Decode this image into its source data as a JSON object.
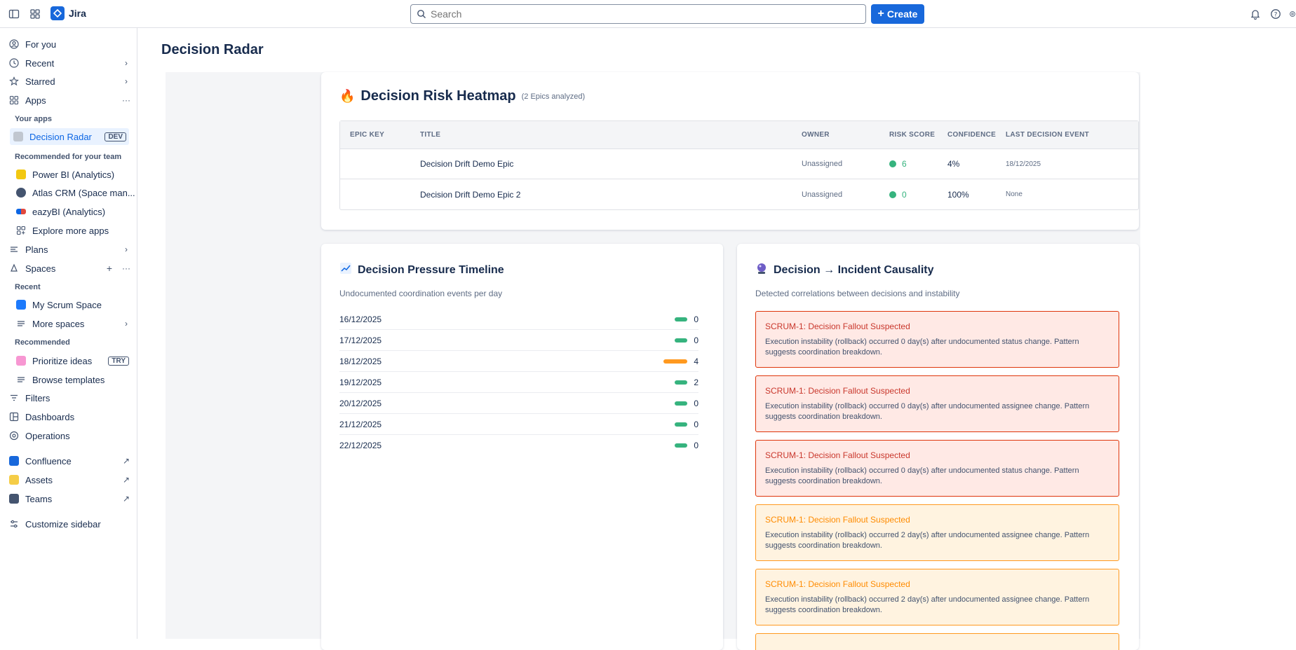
{
  "topbar": {
    "app_name": "Jira",
    "search_placeholder": "Search",
    "create_label": "Create"
  },
  "sidebar": {
    "for_you": "For you",
    "recent": "Recent",
    "starred": "Starred",
    "apps": "Apps",
    "your_apps_heading": "Your apps",
    "decision_radar": "Decision Radar",
    "decision_radar_badge": "DEV",
    "recommended_team_heading": "Recommended for your team",
    "power_bi": "Power BI (Analytics)",
    "atlas_crm": "Atlas CRM (Space man...",
    "eazybi": "eazyBI (Analytics)",
    "explore_apps": "Explore more apps",
    "plans": "Plans",
    "spaces": "Spaces",
    "spaces_recent_heading": "Recent",
    "my_scrum_space": "My Scrum Space",
    "more_spaces": "More spaces",
    "recommended_heading": "Recommended",
    "prioritize_ideas": "Prioritize ideas",
    "prioritize_badge": "TRY",
    "browse_templates": "Browse templates",
    "filters": "Filters",
    "dashboards": "Dashboards",
    "operations": "Operations",
    "confluence": "Confluence",
    "assets": "Assets",
    "teams": "Teams",
    "customize": "Customize sidebar"
  },
  "page": {
    "title": "Decision Radar"
  },
  "heatmap": {
    "title": "Decision Risk Heatmap",
    "subtitle": "(2 Epics analyzed)",
    "headers": {
      "epic_key": "EPIC KEY",
      "title": "TITLE",
      "owner": "OWNER",
      "risk": "RISK SCORE",
      "confidence": "CONFIDENCE",
      "last_event": "LAST DECISION EVENT"
    },
    "rows": [
      {
        "epic_key": "",
        "title": "Decision Drift Demo Epic",
        "owner": "Unassigned",
        "risk": "6",
        "confidence": "4%",
        "last_event": "18/12/2025"
      },
      {
        "epic_key": "",
        "title": "Decision Drift Demo Epic 2",
        "owner": "Unassigned",
        "risk": "0",
        "confidence": "100%",
        "last_event": "None"
      }
    ]
  },
  "timeline": {
    "title": "Decision Pressure Timeline",
    "subtitle": "Undocumented coordination events per day",
    "rows": [
      {
        "date": "16/12/2025",
        "count": "0"
      },
      {
        "date": "17/12/2025",
        "count": "0"
      },
      {
        "date": "18/12/2025",
        "count": "4"
      },
      {
        "date": "19/12/2025",
        "count": "2"
      },
      {
        "date": "20/12/2025",
        "count": "0"
      },
      {
        "date": "21/12/2025",
        "count": "0"
      },
      {
        "date": "22/12/2025",
        "count": "0"
      }
    ]
  },
  "causality": {
    "title": "Decision → Incident Causality",
    "subtitle": "Detected correlations between decisions and instability",
    "alerts": [
      {
        "title": "SCRUM-1: Decision Fallout Suspected",
        "body": "Execution instability (rollback) occurred 0 day(s) after undocumented status change. Pattern suggests coordination breakdown."
      },
      {
        "title": "SCRUM-1: Decision Fallout Suspected",
        "body": "Execution instability (rollback) occurred 0 day(s) after undocumented assignee change. Pattern suggests coordination breakdown."
      },
      {
        "title": "SCRUM-1: Decision Fallout Suspected",
        "body": "Execution instability (rollback) occurred 0 day(s) after undocumented status change. Pattern suggests coordination breakdown."
      },
      {
        "title": "SCRUM-1: Decision Fallout Suspected",
        "body": "Execution instability (rollback) occurred 2 day(s) after undocumented assignee change. Pattern suggests coordination breakdown."
      },
      {
        "title": "SCRUM-1: Decision Fallout Suspected",
        "body": "Execution instability (rollback) occurred 2 day(s) after undocumented assignee change. Pattern suggests coordination breakdown."
      }
    ]
  },
  "colors": {
    "brand": "#1868db",
    "low": "#36b37e",
    "high": "#ff991f",
    "danger": "#de350b"
  }
}
